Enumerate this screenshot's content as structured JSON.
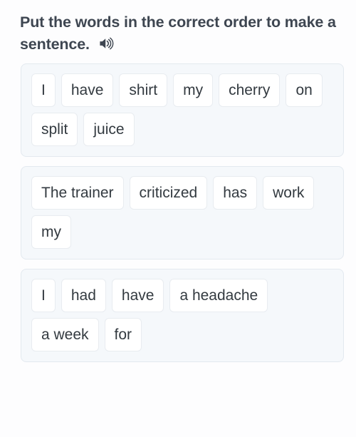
{
  "prompt": {
    "text": "Put the words in the correct order to make a sentence.",
    "audio_icon": "speaker-icon"
  },
  "exercises": [
    {
      "id": "exercise-1",
      "words": [
        "I",
        "have",
        "shirt",
        "my",
        "cherry",
        "on",
        "split",
        "juice"
      ]
    },
    {
      "id": "exercise-2",
      "words": [
        "The trainer",
        "criticized",
        "has",
        "work",
        "my"
      ]
    },
    {
      "id": "exercise-3",
      "words": [
        "I",
        "had",
        "have",
        "a headache",
        "a week",
        "for"
      ]
    }
  ],
  "colors": {
    "page_background": "#fdfdfe",
    "card_background": "#f5f8fb",
    "card_border": "#e3e9ef",
    "chip_background": "#ffffff",
    "chip_border": "#e8ecf0",
    "chip_text": "#333a40",
    "prompt_text": "#3e4651"
  }
}
